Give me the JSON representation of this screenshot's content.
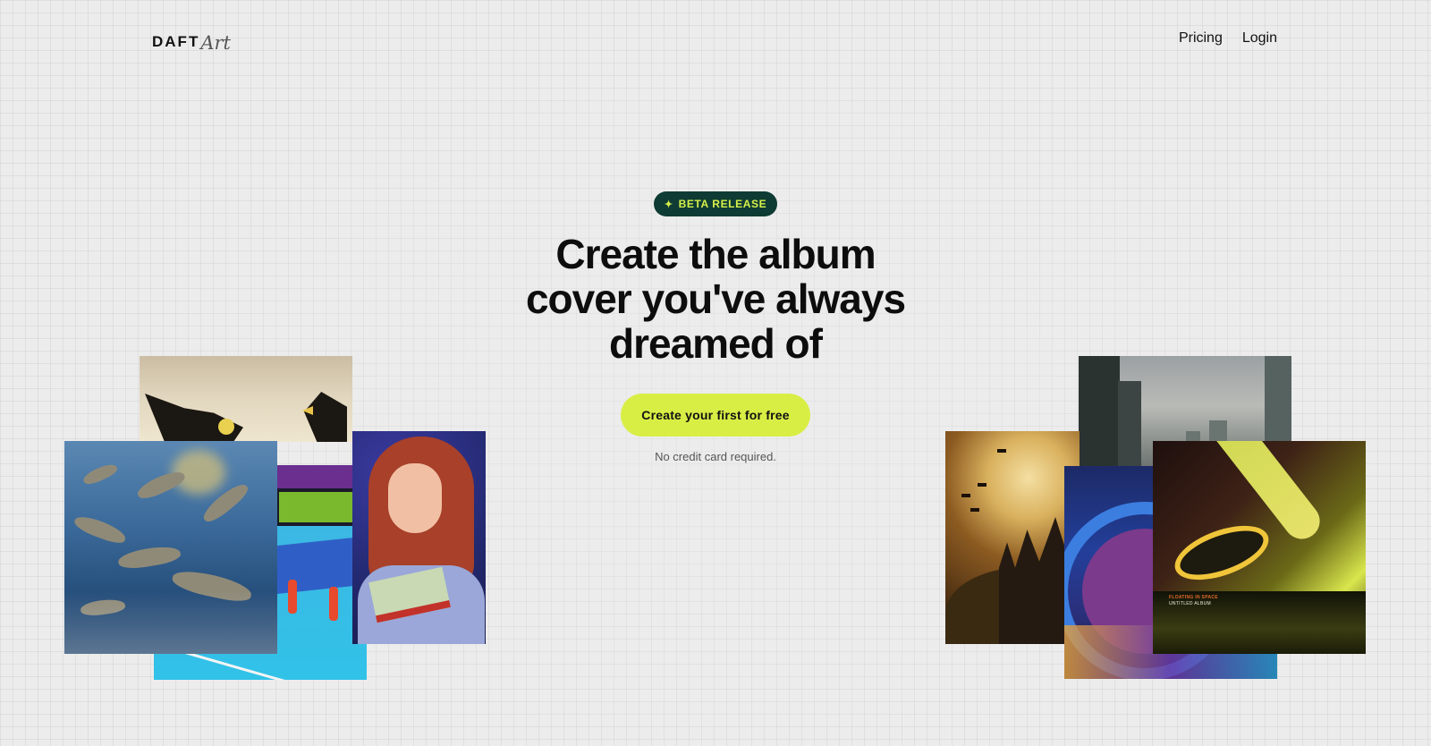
{
  "header": {
    "logo_main": "DAFT",
    "logo_script": "Art",
    "nav": [
      {
        "label": "Pricing"
      },
      {
        "label": "Login"
      }
    ]
  },
  "hero": {
    "badge_icon": "sparkle-icon",
    "badge_label": "BETA RELEASE",
    "headline_line1": "Create the album",
    "headline_line2": "cover you've always",
    "headline_line3": "dreamed of",
    "cta_label": "Create your first for free",
    "subnote": "No credit card required."
  },
  "gallery": {
    "left": [
      "eagles-artwork",
      "volleyball-artwork",
      "reading-girl-artwork",
      "dolphins-artwork"
    ],
    "right": [
      "city-artwork",
      "castle-moon-artwork",
      "planet-artwork",
      "comet-artwork"
    ],
    "comet_caption_line1": "FLOATING IN SPACE",
    "comet_caption_line2": "UNTITLED ALBUM"
  },
  "colors": {
    "background": "#ececec",
    "badge_bg": "#0e3b33",
    "badge_text": "#d6f04a",
    "cta_bg": "#d9ee45"
  }
}
